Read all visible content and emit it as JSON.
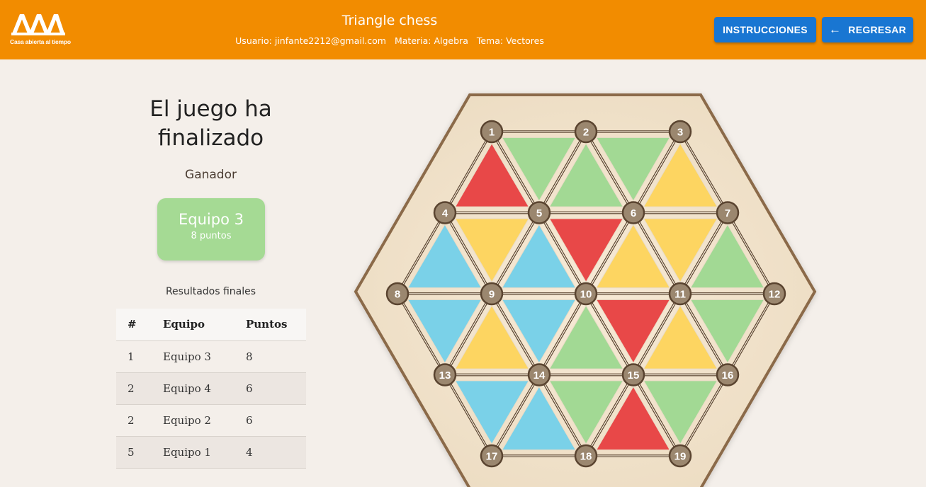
{
  "header": {
    "logo_text": "Casa abierta al tiempo",
    "title": "Triangle chess",
    "user": "Usuario: jinfante2212@gmail.com",
    "subject": "Materia: Algebra",
    "topic": "Tema: Vectores",
    "instructions_label": "INSTRUCCIONES",
    "back_label": "REGRESAR"
  },
  "game_over": {
    "title": "El juego ha finalizado",
    "winner_label": "Ganador",
    "winner_team": "Equipo 3",
    "winner_points": "8 puntos",
    "results_title": "Resultados finales"
  },
  "results": {
    "headers": [
      "#",
      "Equipo",
      "Puntos"
    ],
    "rows": [
      {
        "rank": "1",
        "team": "Equipo 3",
        "points": "8"
      },
      {
        "rank": "2",
        "team": "Equipo 4",
        "points": "6"
      },
      {
        "rank": "2",
        "team": "Equipo 2",
        "points": "6"
      },
      {
        "rank": "5",
        "team": "Equipo 1",
        "points": "4"
      }
    ]
  },
  "colors": {
    "header": "#f28c00",
    "button": "#1976d2",
    "red": "#e84848",
    "green": "#a2d994",
    "yellow": "#fdd561",
    "blue": "#7ad1e8",
    "node": "#9b876f",
    "board_frame": "#8b6a48",
    "board_fill": "#f1e3cd"
  },
  "board": {
    "nodes": [
      {
        "id": "1",
        "r": 0,
        "c": 0
      },
      {
        "id": "2",
        "r": 0,
        "c": 1
      },
      {
        "id": "3",
        "r": 0,
        "c": 2
      },
      {
        "id": "4",
        "r": 1,
        "c": 0
      },
      {
        "id": "5",
        "r": 1,
        "c": 1
      },
      {
        "id": "6",
        "r": 1,
        "c": 2
      },
      {
        "id": "7",
        "r": 1,
        "c": 3
      },
      {
        "id": "8",
        "r": 2,
        "c": 0
      },
      {
        "id": "9",
        "r": 2,
        "c": 1
      },
      {
        "id": "10",
        "r": 2,
        "c": 2
      },
      {
        "id": "11",
        "r": 2,
        "c": 3
      },
      {
        "id": "12",
        "r": 2,
        "c": 4
      },
      {
        "id": "13",
        "r": 3,
        "c": 0
      },
      {
        "id": "14",
        "r": 3,
        "c": 1
      },
      {
        "id": "15",
        "r": 3,
        "c": 2
      },
      {
        "id": "16",
        "r": 3,
        "c": 3
      },
      {
        "id": "17",
        "r": 4,
        "c": 0
      },
      {
        "id": "18",
        "r": 4,
        "c": 1
      },
      {
        "id": "19",
        "r": 4,
        "c": 2
      }
    ],
    "triangles": [
      {
        "v": [
          "1",
          "4",
          "5"
        ],
        "color": "red"
      },
      {
        "v": [
          "1",
          "2",
          "5"
        ],
        "color": "green"
      },
      {
        "v": [
          "2",
          "5",
          "6"
        ],
        "color": "green"
      },
      {
        "v": [
          "2",
          "3",
          "6"
        ],
        "color": "green"
      },
      {
        "v": [
          "3",
          "6",
          "7"
        ],
        "color": "yellow"
      },
      {
        "v": [
          "4",
          "8",
          "9"
        ],
        "color": "blue"
      },
      {
        "v": [
          "4",
          "5",
          "9"
        ],
        "color": "yellow"
      },
      {
        "v": [
          "5",
          "9",
          "10"
        ],
        "color": "blue"
      },
      {
        "v": [
          "5",
          "6",
          "10"
        ],
        "color": "red"
      },
      {
        "v": [
          "6",
          "10",
          "11"
        ],
        "color": "yellow"
      },
      {
        "v": [
          "6",
          "7",
          "11"
        ],
        "color": "yellow"
      },
      {
        "v": [
          "7",
          "11",
          "12"
        ],
        "color": "green"
      },
      {
        "v": [
          "8",
          "9",
          "13"
        ],
        "color": "blue"
      },
      {
        "v": [
          "9",
          "13",
          "14"
        ],
        "color": "yellow"
      },
      {
        "v": [
          "9",
          "10",
          "14"
        ],
        "color": "blue"
      },
      {
        "v": [
          "10",
          "14",
          "15"
        ],
        "color": "green"
      },
      {
        "v": [
          "10",
          "11",
          "15"
        ],
        "color": "red"
      },
      {
        "v": [
          "11",
          "15",
          "16"
        ],
        "color": "yellow"
      },
      {
        "v": [
          "11",
          "12",
          "16"
        ],
        "color": "green"
      },
      {
        "v": [
          "13",
          "14",
          "17"
        ],
        "color": "blue"
      },
      {
        "v": [
          "14",
          "17",
          "18"
        ],
        "color": "blue"
      },
      {
        "v": [
          "14",
          "15",
          "18"
        ],
        "color": "green"
      },
      {
        "v": [
          "15",
          "18",
          "19"
        ],
        "color": "red"
      },
      {
        "v": [
          "15",
          "16",
          "19"
        ],
        "color": "green"
      }
    ]
  }
}
